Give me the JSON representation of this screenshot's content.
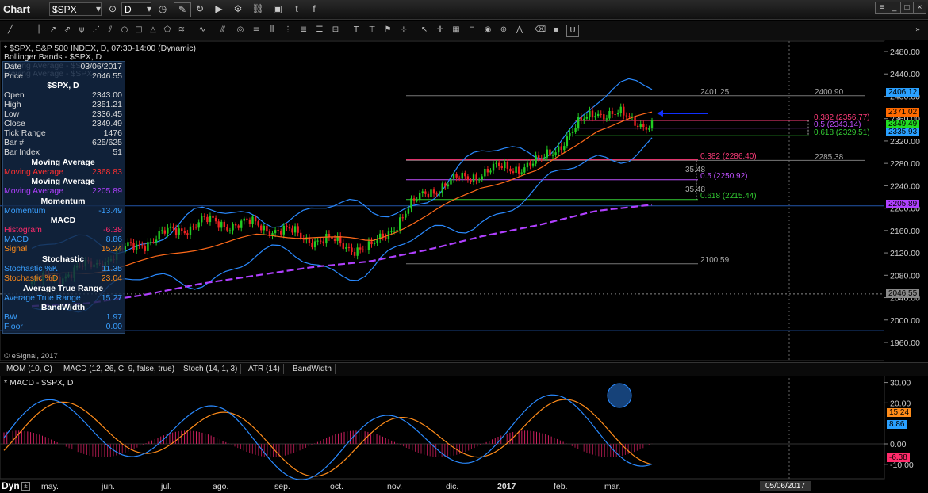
{
  "window": {
    "app_title": "Chart",
    "symbol": "$SPX",
    "interval": "D"
  },
  "chart_header": {
    "line1": "* $SPX, S&P 500 INDEX, D, 07:30-14:00 (Dynamic)",
    "line2": "Bollinger Bands - $SPX, D",
    "line3": "Moving Average - $SPX, D",
    "line4": "Moving Average - $SPX, D",
    "copyright": "© eSignal, 2017"
  },
  "legend": {
    "date_label": "Date",
    "date_value": "03/06/2017",
    "price_label": "Price",
    "price_value": "2046.55",
    "symbol_title": "$SPX, D",
    "rows": [
      {
        "label": "Open",
        "value": "2343.00"
      },
      {
        "label": "High",
        "value": "2351.21"
      },
      {
        "label": "Low",
        "value": "2336.45"
      },
      {
        "label": "Close",
        "value": "2349.49"
      },
      {
        "label": "Tick Range",
        "value": "1476"
      },
      {
        "label": "Bar #",
        "value": "625/625"
      },
      {
        "label": "Bar Index",
        "value": "51"
      }
    ],
    "ma_title": "Moving Average",
    "ma1": {
      "label": "Moving Average",
      "value": "2368.83",
      "color": "#ff3030"
    },
    "ma2": {
      "label": "Moving Average",
      "value": "2205.89",
      "color": "#b040ff"
    },
    "momentum_title": "Momentum",
    "momentum": {
      "label": "Momentum",
      "value": "-13.49",
      "color": "#3aa0ff"
    },
    "macd_title": "MACD",
    "macd_rows": [
      {
        "label": "Histogram",
        "value": "-6.38",
        "color": "#ff2a6a"
      },
      {
        "label": "MACD",
        "value": "8.86",
        "color": "#3aa0ff"
      },
      {
        "label": "Signal",
        "value": "15.24",
        "color": "#ff8c1a"
      }
    ],
    "stoch_title": "Stochastic",
    "stoch_rows": [
      {
        "label": "Stochastic %K",
        "value": "11.35",
        "color": "#3aa0ff"
      },
      {
        "label": "Stochastic %D",
        "value": "23.04",
        "color": "#ff8c1a"
      }
    ],
    "atr_title": "Average True Range",
    "atr": {
      "label": "Average True Range",
      "value": "15.27",
      "color": "#3aa0ff"
    },
    "bw_title": "BandWidth",
    "bw_rows": [
      {
        "label": "BW",
        "value": "1.97",
        "color": "#3aa0ff"
      },
      {
        "label": "Floor",
        "value": "0.00",
        "color": "#3aa0ff"
      }
    ]
  },
  "price_axis": {
    "ticks": [
      "2480.00",
      "2440.00",
      "2400.00",
      "2360.00",
      "2320.00",
      "2280.00",
      "2240.00",
      "2200.00",
      "2160.00",
      "2120.00",
      "2080.00",
      "2040.00",
      "2000.00",
      "1960.00"
    ],
    "tags": [
      {
        "text": "2406.12",
        "color": "#2aa0ff",
        "value": 2406.12
      },
      {
        "text": "2371.02",
        "color": "#ff6a00",
        "value": 2371.02
      },
      {
        "text": "2349.49",
        "color": "#22dd22",
        "value": 2349.49
      },
      {
        "text": "2335.93",
        "color": "#2aa0ff",
        "value": 2335.93
      },
      {
        "text": "2205.89",
        "color": "#b040ff",
        "value": 2205.89
      },
      {
        "text": "2046.55",
        "color": "#888888",
        "value": 2046.55
      }
    ]
  },
  "annotations": {
    "hi_left": "2401.25",
    "hi_right": "2400.90",
    "mid_right": "2285.38",
    "low_mid": "2100.59",
    "fib_small": [
      "0.382 (2356.77)",
      "0.5 (2343.14)",
      "0.618 (2329.51)"
    ],
    "fib_large": [
      "0.382 (2286.40)",
      "0.5 (2250.92)",
      "0.618 (2215.44)"
    ],
    "dist_labels": [
      "35.48",
      "35.48"
    ]
  },
  "tabs": [
    "MOM (10, C)",
    "MACD (12, 26, C, 9, false, true)",
    "Stoch (14, 1, 3)",
    "ATR (14)",
    "BandWidth"
  ],
  "macd_panel": {
    "title": "* MACD - $SPX, D",
    "ticks": [
      "20.00",
      "0.00",
      "-10.00"
    ],
    "top_tick": "30.00",
    "tags": [
      {
        "text": "15.24",
        "color": "#ff8c1a"
      },
      {
        "text": "8.86",
        "color": "#2aa0ff"
      },
      {
        "text": "-6.38",
        "color": "#ff2a6a"
      }
    ]
  },
  "time_axis": {
    "left_label": "Dyn",
    "months": [
      "may.",
      "jun.",
      "jul.",
      "ago.",
      "sep.",
      "oct.",
      "nov.",
      "dic.",
      "2017",
      "feb.",
      "mar."
    ],
    "cursor_date": "05/06/2017"
  },
  "chart_data": {
    "type": "line",
    "title": "* $SPX, S&P 500 INDEX, D, 07:30-14:00 (Dynamic)",
    "ylim": [
      1950,
      2500
    ],
    "x": [
      "may.",
      "jun.",
      "jul.",
      "ago.",
      "sep.",
      "oct.",
      "nov.",
      "dic.",
      "2017",
      "feb.",
      "mar."
    ],
    "series": [
      {
        "name": "Close",
        "values": [
          2065,
          2095,
          2140,
          2175,
          2170,
          2145,
          2125,
          2230,
          2265,
          2280,
          2375,
          2349
        ]
      },
      {
        "name": "Moving Average",
        "values": [
          2075,
          2085,
          2105,
          2130,
          2150,
          2150,
          2140,
          2185,
          2240,
          2265,
          2340,
          2369
        ]
      },
      {
        "name": "Moving Average",
        "values": [
          2025,
          2030,
          2045,
          2065,
          2080,
          2095,
          2105,
          2125,
          2150,
          2170,
          2195,
          2206
        ]
      }
    ]
  }
}
